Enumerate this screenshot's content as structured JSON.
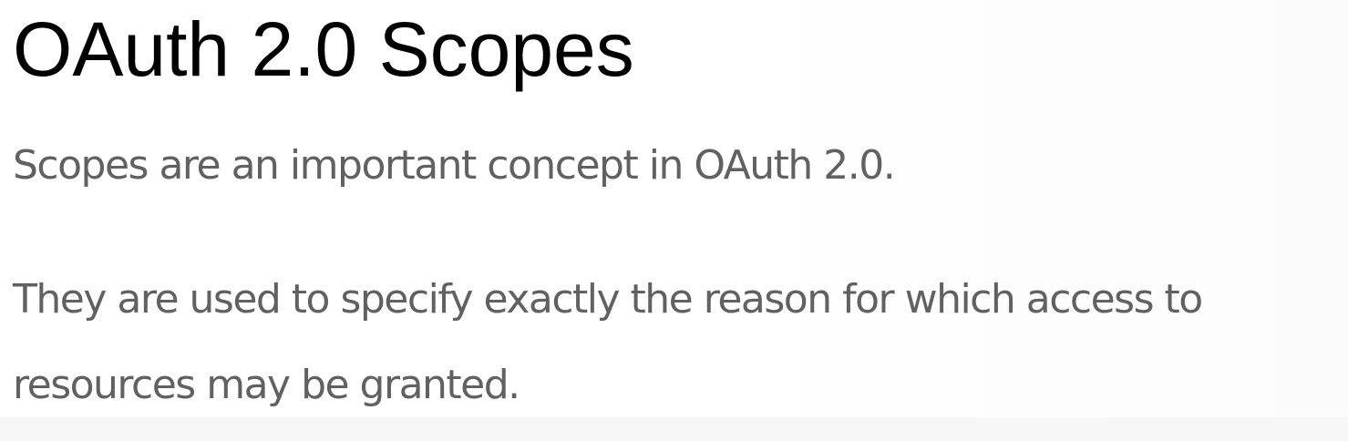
{
  "heading": "OAuth 2.0 Scopes",
  "paragraphs": {
    "p1": "Scopes are an important concept in OAuth 2.0.",
    "p2_line1": "They are used to specify exactly the reason for which access to",
    "p2_line2": "resources may be granted."
  },
  "colors": {
    "heading_text": "#000000",
    "body_text": "#616161",
    "background": "#ffffff"
  }
}
